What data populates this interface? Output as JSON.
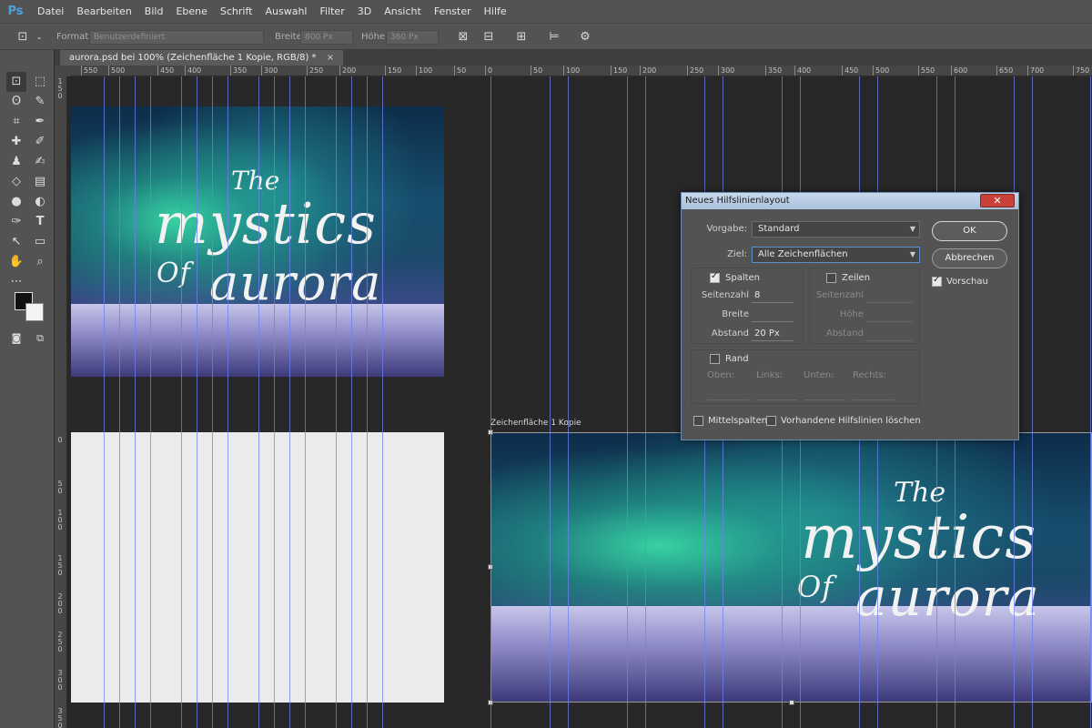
{
  "app": {
    "logo": "Ps"
  },
  "menu": [
    "Datei",
    "Bearbeiten",
    "Bild",
    "Ebene",
    "Schrift",
    "Auswahl",
    "Filter",
    "3D",
    "Ansicht",
    "Fenster",
    "Hilfe"
  ],
  "options": {
    "format_label": "Format:",
    "format_value": "Benutzerdefiniert",
    "width_label": "Breite:",
    "width_value": "800 Px",
    "height_label": "Höhe:",
    "height_value": "360 Px"
  },
  "document": {
    "tab_title": "aurora.psd bei 100% (Zeichenfläche 1 Kopie, RGB/8) *",
    "close": "×"
  },
  "ruler_top": [
    "550",
    "500",
    "450",
    "400",
    "350",
    "300",
    "250",
    "200",
    "150",
    "100",
    "50",
    "0",
    "50",
    "100",
    "150",
    "200",
    "250",
    "300",
    "350",
    "400",
    "450",
    "500",
    "550",
    "600",
    "650",
    "700",
    "750"
  ],
  "ruler_left": [
    "1 5 0",
    "0",
    "5 0",
    "1 0 0",
    "1 5 0",
    "2 0 0",
    "2 5 0",
    "3 0 0",
    "3 5 0"
  ],
  "artboards": {
    "top_left": {
      "the": "The",
      "mystics": "mystics",
      "of": "Of",
      "aurora": "aurora"
    },
    "bottom_right": {
      "label": "Zeichenfläche 1 Kopie",
      "the": "The",
      "mystics": "mystics",
      "of": "Of",
      "aurora": "aurora"
    }
  },
  "dialog": {
    "title": "Neues Hilfslinienlayout",
    "close": "✕",
    "vorgabe_label": "Vorgabe:",
    "vorgabe_value": "Standard",
    "ziel_label": "Ziel:",
    "ziel_value": "Alle Zeichenflächen",
    "spalten_label": "Spalten",
    "spalten_checked": true,
    "zeilen_label": "Zeilen",
    "zeilen_checked": false,
    "col_seitenzahl_label": "Seitenzahl",
    "col_seitenzahl_value": "8",
    "col_breite_label": "Breite",
    "col_breite_value": "",
    "col_abstand_label": "Abstand",
    "col_abstand_value": "20 Px",
    "row_seitenzahl_label": "Seitenzahl",
    "row_hoehe_label": "Höhe",
    "row_abstand_label": "Abstand",
    "rand_label": "Rand",
    "rand_checked": false,
    "oben_label": "Oben:",
    "links_label": "Links:",
    "unten_label": "Unten:",
    "rechts_label": "Rechts:",
    "mittelspalten_label": "Mittelspalten",
    "loeschen_label": "Vorhandene Hilfslinien löschen",
    "ok_label": "OK",
    "cancel_label": "Abbrechen",
    "vorschau_label": "Vorschau",
    "vorschau_checked": true
  }
}
